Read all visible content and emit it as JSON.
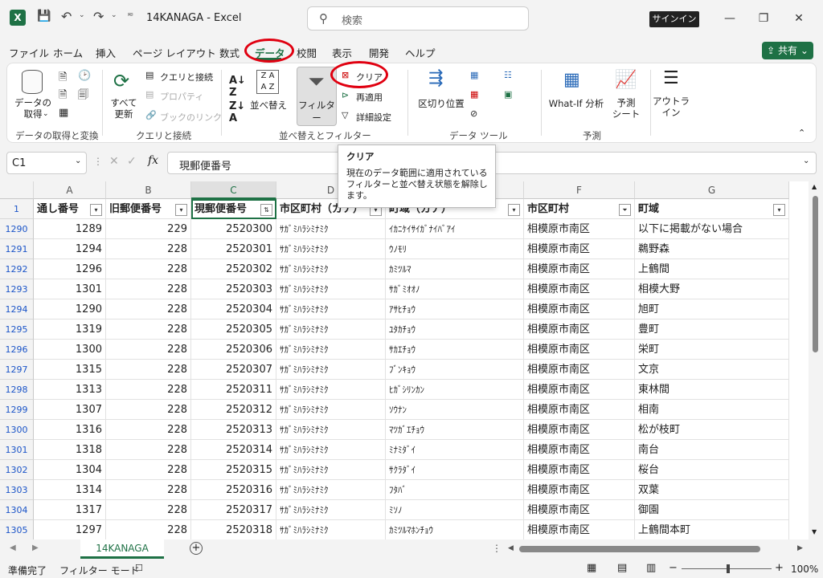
{
  "window": {
    "title": "14KANAGA  -  Excel",
    "search_placeholder": "検索",
    "signin": "サインイン"
  },
  "menu": {
    "items": [
      "ファイル",
      "ホーム",
      "挿入",
      "ページ レイアウト",
      "数式",
      "データ",
      "校閲",
      "表示",
      "開発",
      "ヘルプ"
    ],
    "active": "データ",
    "share": "共有"
  },
  "ribbon": {
    "get_data": "データの\n取得",
    "refresh_all": "すべて\n更新",
    "queries": "クエリと接続",
    "properties": "プロパティ",
    "edit_links": "ブックのリンク",
    "sort": "並べ替え",
    "filter": "フィルター",
    "clear": "クリア",
    "reapply": "再適用",
    "advanced": "詳細設定",
    "text_to_columns": "区切り位置",
    "what_if": "What-If 分析",
    "forecast": "予測\nシート",
    "outline": "アウトラ\nイン",
    "groups": {
      "get_transform": "データの取得と変換",
      "queries": "クエリと接続",
      "sort_filter": "並べ替えとフィルター",
      "data_tools": "データ ツール",
      "forecast": "予測"
    }
  },
  "formula_bar": {
    "name_box": "C1",
    "content": "現郵便番号"
  },
  "tooltip": {
    "title": "クリア",
    "body": "現在のデータ範囲に適用されているフィルターと並べ替え状態を解除します。"
  },
  "grid": {
    "columns": [
      "A",
      "B",
      "C",
      "D",
      "E",
      "F",
      "G"
    ],
    "header_row": "1",
    "headers": [
      "通し番号",
      "旧郵便番号",
      "現郵便番号",
      "市区町村（カナ）",
      "町域（カナ）",
      "市区町村",
      "町域"
    ],
    "rows": [
      {
        "rn": "1290",
        "a": "1289",
        "b": "229",
        "c": "2520300",
        "d": "ｻｶﾞﾐﾊﾗｼﾐﾅﾐｸ",
        "e": "ｲｶﾆｹｲｻｲｶﾞﾅｲﾊﾞｱｲ",
        "f": "相模原市南区",
        "g": "以下に掲載がない場合"
      },
      {
        "rn": "1291",
        "a": "1294",
        "b": "228",
        "c": "2520301",
        "d": "ｻｶﾞﾐﾊﾗｼﾐﾅﾐｸ",
        "e": "ｳﾉﾓﾘ",
        "f": "相模原市南区",
        "g": "鵜野森"
      },
      {
        "rn": "1292",
        "a": "1296",
        "b": "228",
        "c": "2520302",
        "d": "ｻｶﾞﾐﾊﾗｼﾐﾅﾐｸ",
        "e": "ｶﾐﾂﾙﾏ",
        "f": "相模原市南区",
        "g": "上鶴間"
      },
      {
        "rn": "1293",
        "a": "1301",
        "b": "228",
        "c": "2520303",
        "d": "ｻｶﾞﾐﾊﾗｼﾐﾅﾐｸ",
        "e": "ｻｶﾞﾐｵｵﾉ",
        "f": "相模原市南区",
        "g": "相模大野"
      },
      {
        "rn": "1294",
        "a": "1290",
        "b": "228",
        "c": "2520304",
        "d": "ｻｶﾞﾐﾊﾗｼﾐﾅﾐｸ",
        "e": "ｱｻﾋﾁｮｳ",
        "f": "相模原市南区",
        "g": "旭町"
      },
      {
        "rn": "1295",
        "a": "1319",
        "b": "228",
        "c": "2520305",
        "d": "ｻｶﾞﾐﾊﾗｼﾐﾅﾐｸ",
        "e": "ﾕﾀｶﾁｮｳ",
        "f": "相模原市南区",
        "g": "豊町"
      },
      {
        "rn": "1296",
        "a": "1300",
        "b": "228",
        "c": "2520306",
        "d": "ｻｶﾞﾐﾊﾗｼﾐﾅﾐｸ",
        "e": "ｻｶｴﾁｮｳ",
        "f": "相模原市南区",
        "g": "栄町"
      },
      {
        "rn": "1297",
        "a": "1315",
        "b": "228",
        "c": "2520307",
        "d": "ｻｶﾞﾐﾊﾗｼﾐﾅﾐｸ",
        "e": "ﾌﾞﾝｷｮｳ",
        "f": "相模原市南区",
        "g": "文京"
      },
      {
        "rn": "1298",
        "a": "1313",
        "b": "228",
        "c": "2520311",
        "d": "ｻｶﾞﾐﾊﾗｼﾐﾅﾐｸ",
        "e": "ﾋｶﾞｼﾘﾝｶﾝ",
        "f": "相模原市南区",
        "g": "東林間"
      },
      {
        "rn": "1299",
        "a": "1307",
        "b": "228",
        "c": "2520312",
        "d": "ｻｶﾞﾐﾊﾗｼﾐﾅﾐｸ",
        "e": "ｿｳﾅﾝ",
        "f": "相模原市南区",
        "g": "相南"
      },
      {
        "rn": "1300",
        "a": "1316",
        "b": "228",
        "c": "2520313",
        "d": "ｻｶﾞﾐﾊﾗｼﾐﾅﾐｸ",
        "e": "ﾏﾂｶﾞｴﾁｮｳ",
        "f": "相模原市南区",
        "g": "松が枝町"
      },
      {
        "rn": "1301",
        "a": "1318",
        "b": "228",
        "c": "2520314",
        "d": "ｻｶﾞﾐﾊﾗｼﾐﾅﾐｸ",
        "e": "ﾐﾅﾐﾀﾞｲ",
        "f": "相模原市南区",
        "g": "南台"
      },
      {
        "rn": "1302",
        "a": "1304",
        "b": "228",
        "c": "2520315",
        "d": "ｻｶﾞﾐﾊﾗｼﾐﾅﾐｸ",
        "e": "ｻｸﾗﾀﾞｲ",
        "f": "相模原市南区",
        "g": "桜台"
      },
      {
        "rn": "1303",
        "a": "1314",
        "b": "228",
        "c": "2520316",
        "d": "ｻｶﾞﾐﾊﾗｼﾐﾅﾐｸ",
        "e": "ﾌﾀﾊﾞ",
        "f": "相模原市南区",
        "g": "双葉"
      },
      {
        "rn": "1304",
        "a": "1317",
        "b": "228",
        "c": "2520317",
        "d": "ｻｶﾞﾐﾊﾗｼﾐﾅﾐｸ",
        "e": "ﾐｿﾉ",
        "f": "相模原市南区",
        "g": "御園"
      },
      {
        "rn": "1305",
        "a": "1297",
        "b": "228",
        "c": "2520318",
        "d": "ｻｶﾞﾐﾊﾗｼﾐﾅﾐｸ",
        "e": "ｶﾐﾂﾙﾏﾎﾝﾁｮｳ",
        "f": "相模原市南区",
        "g": "上鶴間本町"
      }
    ]
  },
  "sheet": {
    "tab": "14KANAGA",
    "add": "+"
  },
  "status": {
    "ready": "準備完了",
    "mode": "フィルター モード",
    "zoom": "100%"
  },
  "colors": {
    "accent": "#1e7145",
    "annotation": "#e00010"
  }
}
